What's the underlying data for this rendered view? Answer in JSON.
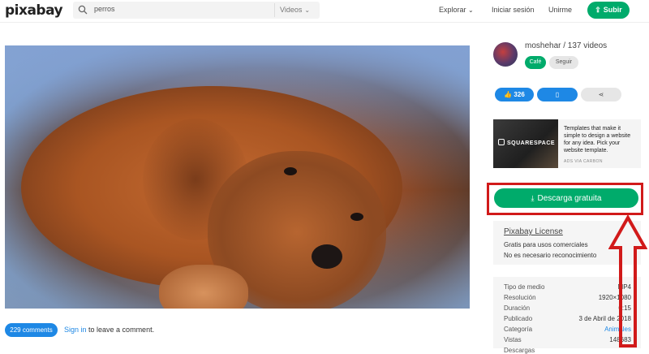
{
  "header": {
    "logo": "pixabay",
    "search": {
      "query": "perros",
      "type": "Videos"
    },
    "nav": {
      "explore": "Explorar",
      "login": "Iniciar sesión",
      "join": "Unirme",
      "upload": "Subir"
    }
  },
  "author": {
    "line": "moshehar / 137 videos",
    "cafe": "Café",
    "follow": "Seguir"
  },
  "actions": {
    "likes": "326"
  },
  "ad": {
    "brand": "SQUARESPACE",
    "text": "Templates that make it simple to design a website for any idea. Pick your website template.",
    "via": "ADS VIA CARBON"
  },
  "download": {
    "label": "Descarga gratuita"
  },
  "license": {
    "title": "Pixabay License",
    "line1": "Gratis para usos comerciales",
    "line2": "No es necesario reconocimiento"
  },
  "meta": {
    "media_type": {
      "label": "Tipo de medio",
      "value": "MP4"
    },
    "resolution": {
      "label": "Resolución",
      "value": "1920×1080"
    },
    "duration": {
      "label": "Duración",
      "value": "0:15"
    },
    "published": {
      "label": "Publicado",
      "value": "3 de Abril de 2018"
    },
    "category": {
      "label": "Categoría",
      "value": "Animales"
    },
    "views": {
      "label": "Vistas",
      "value": "148683"
    },
    "downloads": {
      "label": "Descargas",
      "value": ""
    }
  },
  "comments": {
    "count": "229 comments",
    "signin": "Sign in",
    "suffix": " to leave a comment."
  },
  "colors": {
    "accent_green": "#00ab6b",
    "accent_blue": "#1e88e5",
    "highlight_red": "#d11a1a"
  }
}
